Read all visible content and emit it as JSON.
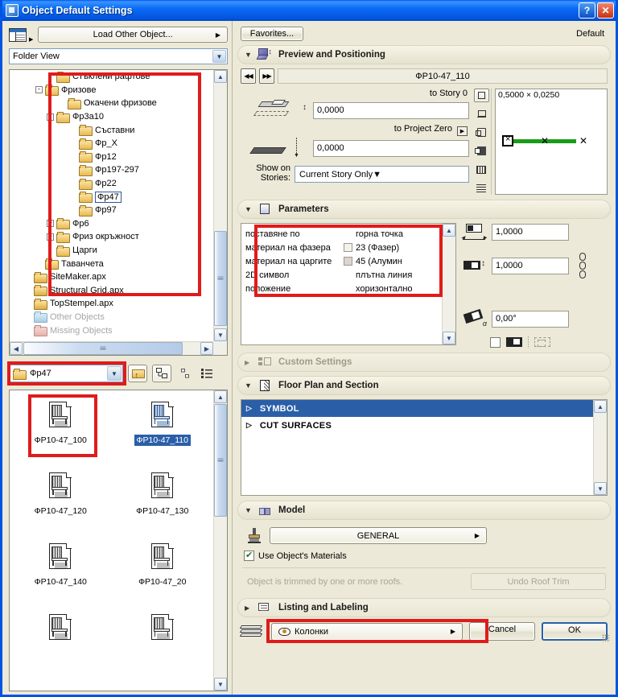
{
  "window": {
    "title": "Object Default Settings",
    "help_label": "?",
    "close_label": "✕"
  },
  "left": {
    "load_other_object": "Load Other Object...",
    "view_mode": "Folder View",
    "tree": [
      {
        "label": "Стъклени рафтове",
        "indent": 3,
        "toggle": "",
        "state": "normal"
      },
      {
        "label": "Фризове",
        "indent": 2,
        "toggle": "-",
        "state": "normal"
      },
      {
        "label": "Окачени фризове",
        "indent": 4,
        "toggle": "",
        "state": "normal"
      },
      {
        "label": "Фр3a10",
        "indent": 3,
        "toggle": "-",
        "state": "normal"
      },
      {
        "label": "Съставни",
        "indent": 5,
        "toggle": "",
        "state": "normal"
      },
      {
        "label": "Фр_X",
        "indent": 5,
        "toggle": "",
        "state": "normal"
      },
      {
        "label": "Фр12",
        "indent": 5,
        "toggle": "",
        "state": "normal"
      },
      {
        "label": "Фр197-297",
        "indent": 5,
        "toggle": "",
        "state": "normal"
      },
      {
        "label": "Фр22",
        "indent": 5,
        "toggle": "",
        "state": "normal"
      },
      {
        "label": "Фр47",
        "indent": 5,
        "toggle": "",
        "state": "selected"
      },
      {
        "label": "Фр97",
        "indent": 5,
        "toggle": "",
        "state": "normal"
      },
      {
        "label": "Фр6",
        "indent": 3,
        "toggle": "+",
        "state": "normal"
      },
      {
        "label": "Фриз окръжност",
        "indent": 3,
        "toggle": "+",
        "state": "normal"
      },
      {
        "label": "Царги",
        "indent": 3,
        "toggle": "",
        "state": "normal"
      },
      {
        "label": "Таванчета",
        "indent": 2,
        "toggle": "",
        "state": "normal"
      },
      {
        "label": "SiteMaker.apx",
        "indent": 1,
        "toggle": "",
        "state": "apx"
      },
      {
        "label": "Structural Grid.apx",
        "indent": 1,
        "toggle": "",
        "state": "apx"
      },
      {
        "label": "TopStempel.apx",
        "indent": 1,
        "toggle": "",
        "state": "apx"
      },
      {
        "label": "Other Objects",
        "indent": 1,
        "toggle": "",
        "state": "dim"
      },
      {
        "label": "Missing Objects",
        "indent": 1,
        "toggle": "",
        "state": "missing"
      }
    ],
    "current_folder": "Фр47",
    "thumbnails": [
      {
        "name": "ФР10-47_100",
        "selected": false,
        "highlighted": true
      },
      {
        "name": "ФР10-47_110",
        "selected": true,
        "highlighted": false
      },
      {
        "name": "ФР10-47_120",
        "selected": false,
        "highlighted": false
      },
      {
        "name": "ФР10-47_130",
        "selected": false,
        "highlighted": false
      },
      {
        "name": "ФР10-47_140",
        "selected": false,
        "highlighted": false
      },
      {
        "name": "ФР10-47_20",
        "selected": false,
        "highlighted": false
      }
    ]
  },
  "right": {
    "favorites_label": "Favorites...",
    "default_label": "Default",
    "preview": {
      "section_title": "Preview and Positioning",
      "object_name": "ФР10-47_110",
      "to_story_label": "to Story 0",
      "to_story_value": "0,0000",
      "to_project_zero_label": "to Project Zero",
      "to_project_zero_value": "0,0000",
      "show_on_stories_label": "Show on Stories:",
      "show_on_stories_value": "Current Story Only",
      "dimensions": "0,5000 × 0,0250"
    },
    "parameters": {
      "section_title": "Parameters",
      "rows": [
        {
          "name": "поставяне по",
          "value": "горна точка",
          "swatch": ""
        },
        {
          "name": "материал на фазера",
          "value": "23 (Фазер)",
          "swatch": "#f4f2ea"
        },
        {
          "name": "материал на царгите",
          "value": "45 (Алумин",
          "swatch": "#ded4d2"
        },
        {
          "name": "2D символ",
          "value": "плътна линия",
          "swatch": ""
        },
        {
          "name": "положение",
          "value": "хоризонтално",
          "swatch": ""
        }
      ],
      "width_value": "1,0000",
      "height_value": "1,0000",
      "angle_value": "0,00°"
    },
    "custom_settings": {
      "section_title": "Custom Settings"
    },
    "floor_plan": {
      "section_title": "Floor Plan and Section",
      "items": [
        {
          "label": "SYMBOL",
          "selected": true
        },
        {
          "label": "CUT SURFACES",
          "selected": false
        }
      ]
    },
    "model": {
      "section_title": "Model",
      "general_label": "GENERAL",
      "use_materials_label": "Use Object's Materials",
      "trim_note": "Object is trimmed by one or more roofs.",
      "undo_roof_trim": "Undo Roof Trim"
    },
    "listing": {
      "section_title": "Listing and Labeling"
    },
    "footer": {
      "layer_label": "Колонки",
      "cancel_label": "Cancel",
      "ok_label": "OK"
    }
  },
  "colors": {
    "accent": "#0054e3",
    "highlight": "#e01b1b",
    "selection": "#2a5fa8",
    "green": "#1a9c1a"
  }
}
